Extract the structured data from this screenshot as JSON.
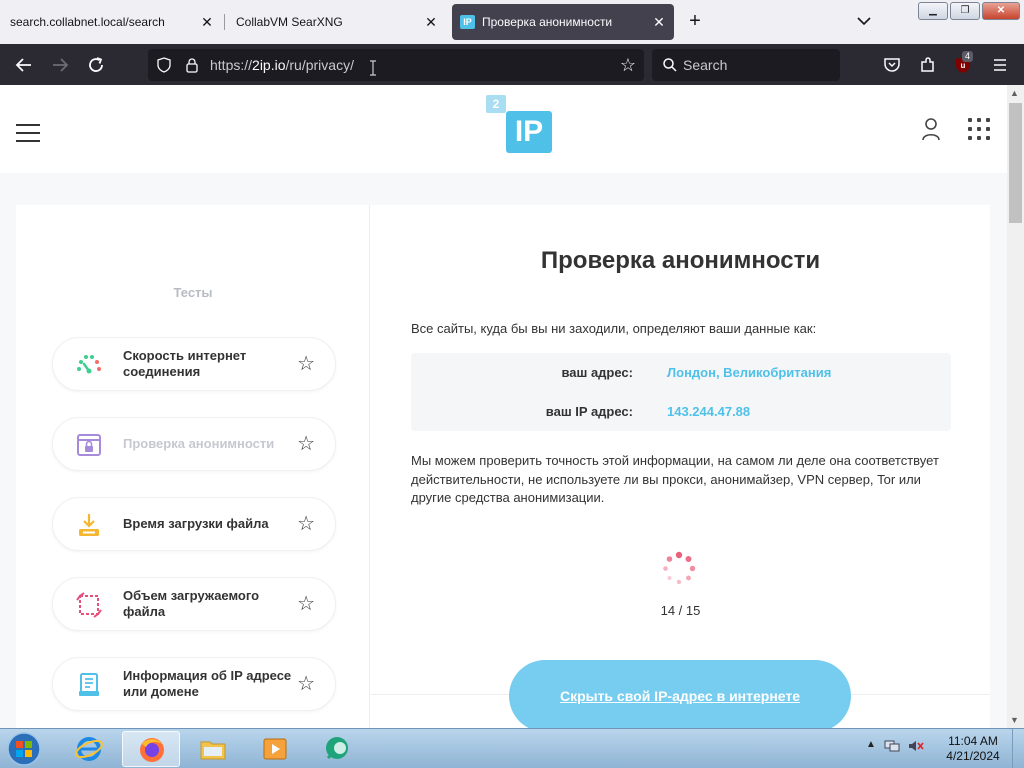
{
  "browser": {
    "tabs": [
      {
        "title": "search.collabnet.local/search",
        "active": false
      },
      {
        "title": "CollabVM SearXNG",
        "active": false
      },
      {
        "title": "Проверка анонимности",
        "active": true,
        "favicon": "IP"
      }
    ],
    "url_prefix": "https://",
    "url_host": "2ip.io",
    "url_path": "/ru/privacy/",
    "search_placeholder": "Search",
    "ublock_count": "4"
  },
  "site": {
    "logo_small": "2",
    "logo_big": "IP",
    "sidebar_title": "Тесты",
    "tests": [
      {
        "label": "Скорость интернет соединения",
        "icon": "speedometer-icon",
        "active": false
      },
      {
        "label": "Проверка анонимности",
        "icon": "lock-window-icon",
        "active": true
      },
      {
        "label": "Время загрузки файла",
        "icon": "download-icon",
        "active": false
      },
      {
        "label": "Объем загружаемого файла",
        "icon": "resize-icon",
        "active": false
      },
      {
        "label": "Информация об IP адресе или домене",
        "icon": "document-icon",
        "active": false
      }
    ],
    "page_title": "Проверка анонимности",
    "intro": "Все сайты, куда бы вы ни заходили, определяют ваши данные как:",
    "info": [
      {
        "key": "ваш адрес:",
        "value": "Лондон, Великобритания"
      },
      {
        "key": "ваш IP адрес:",
        "value": "143.244.47.88"
      }
    ],
    "paragraph": "Мы можем проверить точность этой информации, на самом ли деле она соответствует действительности, не используете ли вы прокси, анонимайзер, VPN сервер, Tor или другие средства анонимизации.",
    "progress_text": "14 / 15",
    "hide_button": "Скрыть свой IP-адрес в интернете"
  },
  "taskbar": {
    "time": "11:04 AM",
    "date": "4/21/2024"
  },
  "colors": {
    "accent": "#4fc1e9",
    "browser_dark": "#2b2a33",
    "tabstrip": "#f0f0f4"
  }
}
